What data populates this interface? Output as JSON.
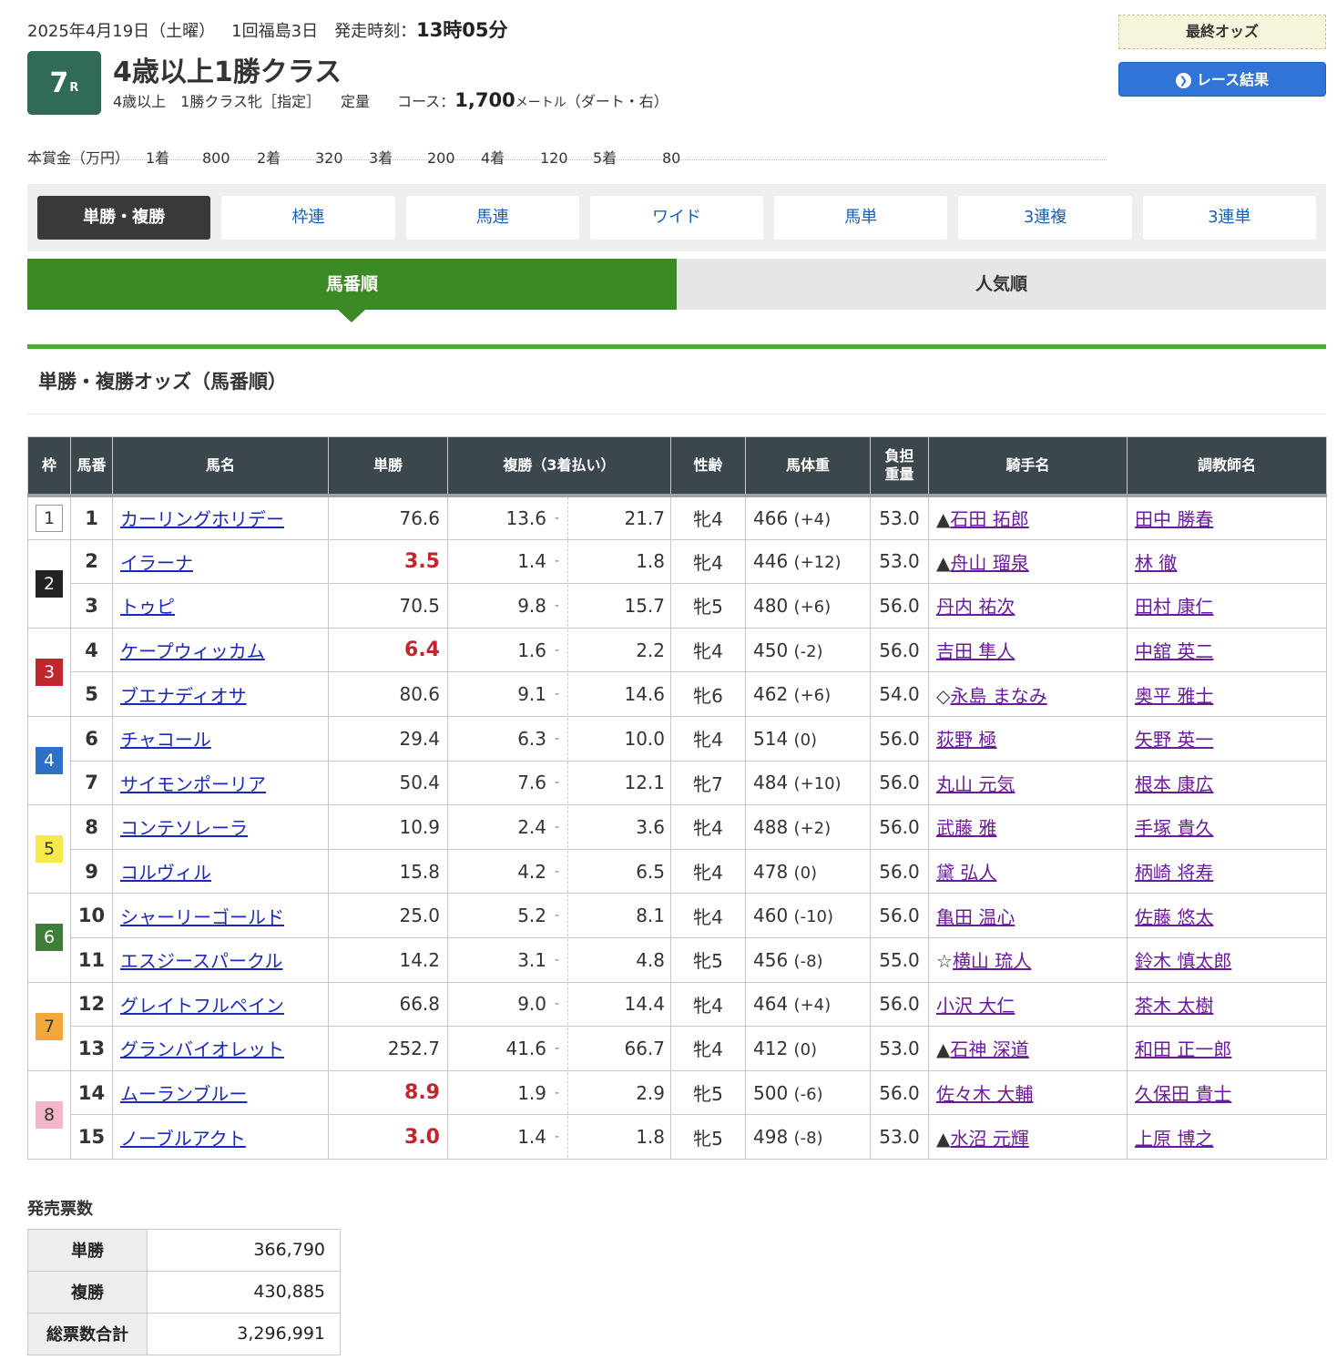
{
  "header": {
    "date": "2025年4月19日（土曜）",
    "meeting": "1回福島3日",
    "post_time_label": "発走時刻：",
    "post_time": "13時05分",
    "race_number": "7",
    "race_r": "R",
    "race_title": "4歳以上1勝クラス",
    "cond1": "4歳以上　1勝クラス牝［指定］",
    "cond2": "定量",
    "course_label": "コース：",
    "distance": "1,700",
    "distance_unit": "メートル",
    "course_detail": "（ダート・右）"
  },
  "buttons": {
    "final_odds": "最終オッズ",
    "race_result": "レース結果"
  },
  "prize": {
    "label": "本賞金（万円）",
    "items": [
      {
        "place": "1着",
        "amount": "800"
      },
      {
        "place": "2着",
        "amount": "320"
      },
      {
        "place": "3着",
        "amount": "200"
      },
      {
        "place": "4着",
        "amount": "120"
      },
      {
        "place": "5着",
        "amount": "80"
      }
    ]
  },
  "ticket_tabs": [
    "単勝・複勝",
    "枠連",
    "馬連",
    "ワイド",
    "馬単",
    "3連複",
    "3連単"
  ],
  "order_tabs": [
    "馬番順",
    "人気順"
  ],
  "section_title": "単勝・複勝オッズ（馬番順）",
  "table": {
    "headers": {
      "waku": "枠",
      "umaban": "馬番",
      "horse": "馬名",
      "win": "単勝",
      "place": "複勝（3着払い）",
      "sex_age": "性齢",
      "weight": "馬体重",
      "load_1": "負担",
      "load_2": "重量",
      "jockey": "騎手名",
      "trainer": "調教師名"
    },
    "place_sep": "-",
    "rows": [
      {
        "waku": "1",
        "num": "1",
        "horse": "カーリングホリデー",
        "win": "76.6",
        "pmin": "13.6",
        "pmax": "21.7",
        "sex": "牝4",
        "bw": "466",
        "diff": "(+4)",
        "load": "53.0",
        "mark": "▲",
        "jockey": "石田 拓郎",
        "trainer": "田中 勝春"
      },
      {
        "waku": "2",
        "num": "2",
        "horse": "イラーナ",
        "win": "3.5",
        "pmin": "1.4",
        "pmax": "1.8",
        "sex": "牝4",
        "bw": "446",
        "diff": "(+12)",
        "load": "53.0",
        "mark": "▲",
        "jockey": "舟山 瑠泉",
        "trainer": "林 徹"
      },
      {
        "waku": "2",
        "num": "3",
        "horse": "トゥピ",
        "win": "70.5",
        "pmin": "9.8",
        "pmax": "15.7",
        "sex": "牝5",
        "bw": "480",
        "diff": "(+6)",
        "load": "56.0",
        "mark": "",
        "jockey": "丹内 祐次",
        "trainer": "田村 康仁"
      },
      {
        "waku": "3",
        "num": "4",
        "horse": "ケープウィッカム",
        "win": "6.4",
        "pmin": "1.6",
        "pmax": "2.2",
        "sex": "牝4",
        "bw": "450",
        "diff": "(-2)",
        "load": "56.0",
        "mark": "",
        "jockey": "吉田 隼人",
        "trainer": "中舘 英二"
      },
      {
        "waku": "3",
        "num": "5",
        "horse": "ブエナディオサ",
        "win": "80.6",
        "pmin": "9.1",
        "pmax": "14.6",
        "sex": "牝6",
        "bw": "462",
        "diff": "(+6)",
        "load": "54.0",
        "mark": "◇",
        "jockey": "永島 まなみ",
        "trainer": "奥平 雅士"
      },
      {
        "waku": "4",
        "num": "6",
        "horse": "チャコール",
        "win": "29.4",
        "pmin": "6.3",
        "pmax": "10.0",
        "sex": "牝4",
        "bw": "514",
        "diff": "(0)",
        "load": "56.0",
        "mark": "",
        "jockey": "荻野 極",
        "trainer": "矢野 英一"
      },
      {
        "waku": "4",
        "num": "7",
        "horse": "サイモンポーリア",
        "win": "50.4",
        "pmin": "7.6",
        "pmax": "12.1",
        "sex": "牝7",
        "bw": "484",
        "diff": "(+10)",
        "load": "56.0",
        "mark": "",
        "jockey": "丸山 元気",
        "trainer": "根本 康広"
      },
      {
        "waku": "5",
        "num": "8",
        "horse": "コンテソレーラ",
        "win": "10.9",
        "pmin": "2.4",
        "pmax": "3.6",
        "sex": "牝4",
        "bw": "488",
        "diff": "(+2)",
        "load": "56.0",
        "mark": "",
        "jockey": "武藤 雅",
        "trainer": "手塚 貴久"
      },
      {
        "waku": "5",
        "num": "9",
        "horse": "コルヴィル",
        "win": "15.8",
        "pmin": "4.2",
        "pmax": "6.5",
        "sex": "牝4",
        "bw": "478",
        "diff": "(0)",
        "load": "56.0",
        "mark": "",
        "jockey": "黛 弘人",
        "trainer": "柄崎 将寿"
      },
      {
        "waku": "6",
        "num": "10",
        "horse": "シャーリーゴールド",
        "win": "25.0",
        "pmin": "5.2",
        "pmax": "8.1",
        "sex": "牝4",
        "bw": "460",
        "diff": "(-10)",
        "load": "56.0",
        "mark": "",
        "jockey": "亀田 温心",
        "trainer": "佐藤 悠太"
      },
      {
        "waku": "6",
        "num": "11",
        "horse": "エスジースパークル",
        "win": "14.2",
        "pmin": "3.1",
        "pmax": "4.8",
        "sex": "牝5",
        "bw": "456",
        "diff": "(-8)",
        "load": "55.0",
        "mark": "☆",
        "jockey": "横山 琉人",
        "trainer": "鈴木 慎太郎"
      },
      {
        "waku": "7",
        "num": "12",
        "horse": "グレイトフルペイン",
        "win": "66.8",
        "pmin": "9.0",
        "pmax": "14.4",
        "sex": "牝4",
        "bw": "464",
        "diff": "(+4)",
        "load": "56.0",
        "mark": "",
        "jockey": "小沢 大仁",
        "trainer": "茶木 太樹"
      },
      {
        "waku": "7",
        "num": "13",
        "horse": "グランバイオレット",
        "win": "252.7",
        "pmin": "41.6",
        "pmax": "66.7",
        "sex": "牝4",
        "bw": "412",
        "diff": "(0)",
        "load": "53.0",
        "mark": "▲",
        "jockey": "石神 深道",
        "trainer": "和田 正一郎"
      },
      {
        "waku": "8",
        "num": "14",
        "horse": "ムーランブルー",
        "win": "8.9",
        "pmin": "1.9",
        "pmax": "2.9",
        "sex": "牝5",
        "bw": "500",
        "diff": "(-6)",
        "load": "56.0",
        "mark": "",
        "jockey": "佐々木 大輔",
        "trainer": "久保田 貴士"
      },
      {
        "waku": "8",
        "num": "15",
        "horse": "ノーブルアクト",
        "win": "3.0",
        "pmin": "1.4",
        "pmax": "1.8",
        "sex": "牝5",
        "bw": "498",
        "diff": "(-8)",
        "load": "53.0",
        "mark": "▲",
        "jockey": "水沼 元輝",
        "trainer": "上原 博之"
      }
    ]
  },
  "favorites": [
    "2",
    "4",
    "14",
    "15"
  ],
  "waku_colors": {
    "1": {
      "bg": "#ffffff",
      "fg": "#333333"
    },
    "2": {
      "bg": "#222222",
      "fg": "#ffffff"
    },
    "3": {
      "bg": "#c0262d",
      "fg": "#ffffff"
    },
    "4": {
      "bg": "#2f6fc7",
      "fg": "#ffffff"
    },
    "5": {
      "bg": "#f8e94a",
      "fg": "#333333"
    },
    "6": {
      "bg": "#3f7d3a",
      "fg": "#ffffff"
    },
    "7": {
      "bg": "#f2a83b",
      "fg": "#333333"
    },
    "8": {
      "bg": "#f4b7c8",
      "fg": "#333333"
    }
  },
  "votes": {
    "title": "発売票数",
    "rows": [
      {
        "k": "単勝",
        "v": "366,790"
      },
      {
        "k": "複勝",
        "v": "430,885"
      },
      {
        "k": "総票数合計",
        "v": "3,296,991"
      }
    ]
  },
  "colors": {
    "accent_green": "#3b8a25",
    "race_badge": "#2f6b55",
    "link_blue": "#1c29b8",
    "link_purple": "#6a1b9a",
    "favorite_red": "#c0262d"
  }
}
